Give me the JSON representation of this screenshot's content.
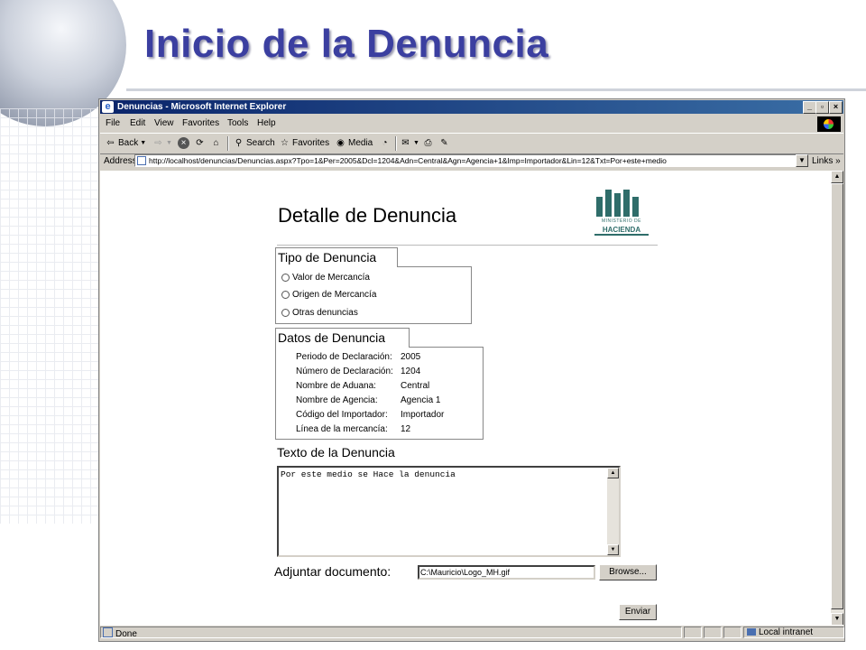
{
  "slide": {
    "title": "Inicio de la Denuncia"
  },
  "window": {
    "title": "Denuncias - Microsoft Internet Explorer",
    "controls": {
      "minimize": "_",
      "maximize": "▫",
      "close": "×"
    }
  },
  "menu": {
    "items": [
      "File",
      "Edit",
      "View",
      "Favorites",
      "Tools",
      "Help"
    ]
  },
  "toolbar": {
    "back": "Back",
    "search": "Search",
    "favorites": "Favorites",
    "media": "Media"
  },
  "address": {
    "label": "Address",
    "url": "http://localhost/denuncias/Denuncias.aspx?Tpo=1&Per=2005&Dcl=1204&Adn=Central&Agn=Agencia+1&Imp=Importador&Lin=12&Txt=Por+este+medio",
    "links": "Links"
  },
  "page": {
    "heading": "Detalle de Denuncia",
    "logo": {
      "small": "MINISTERIO DE",
      "big": "HACIENDA"
    },
    "tipo": {
      "legend": "Tipo de Denuncia",
      "options": [
        "Valor de Mercancía",
        "Origen de Mercancía",
        "Otras denuncias"
      ]
    },
    "datos": {
      "legend": "Datos de Denuncia",
      "rows": [
        {
          "label": "Periodo de Declaración:",
          "value": "2005"
        },
        {
          "label": "Número de Declaración:",
          "value": "1204"
        },
        {
          "label": "Nombre de Aduana:",
          "value": "Central"
        },
        {
          "label": "Nombre de Agencia:",
          "value": "Agencia 1"
        },
        {
          "label": "Código del Importador:",
          "value": "Importador"
        },
        {
          "label": "Línea de la mercancía:",
          "value": "12"
        }
      ]
    },
    "texto": {
      "label": "Texto de la Denuncia",
      "value": "Por este medio se Hace la denuncia"
    },
    "adjuntar": {
      "label": "Adjuntar documento:",
      "value": "C:\\Mauricio\\Logo_MH.gif",
      "browse": "Browse..."
    },
    "enviar": "Enviar"
  },
  "status": {
    "text": "Done",
    "zone": "Local intranet"
  }
}
